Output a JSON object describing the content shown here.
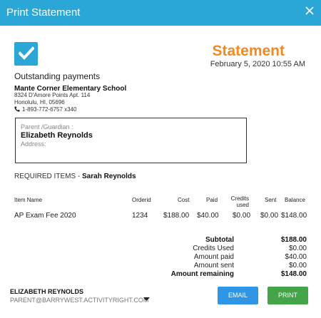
{
  "window": {
    "title": "Print Statement",
    "title_bg": "#2aa7d6"
  },
  "logo": {
    "icon": "checkmark-icon",
    "color": "#2aa7d6"
  },
  "statement": {
    "title": "Statement",
    "title_color": "#f08a24",
    "date": "February 5, 2020 10:55 AM"
  },
  "school": {
    "heading": "Outstanding payments",
    "name": "Mante Corner Elementary School",
    "address_line1": "8324 D'Amore Points Apt. 114",
    "address_line2": "Honolulu, HI, 05696",
    "phone": "1-893-772-6757 x340"
  },
  "guardian": {
    "label": "Parent /Guardian :",
    "name": "Elizabeth Reynolds",
    "address_label": "Address:"
  },
  "required": {
    "label": "REQUIRED ITEMS - ",
    "student": "Sarah Reynolds"
  },
  "table": {
    "headers": {
      "item": "Item Name",
      "order": "Orderid",
      "cost": "Cost",
      "paid": "Paid",
      "credits": "Credits used",
      "sent": "Sent",
      "balance": "Balance"
    },
    "rows": [
      {
        "item": "AP Exam Fee 2020",
        "order": "1234",
        "cost": "$188.00",
        "paid": "$40.00",
        "credits": "$0.00",
        "sent": "$0.00",
        "balance": "$148.00"
      }
    ]
  },
  "summary": {
    "subtotal_label": "Subtotal",
    "subtotal": "$188.00",
    "credits_label": "Credits Used",
    "credits": "$0.00",
    "paid_label": "Amount paid",
    "paid": "$40.00",
    "sent_label": "Amount sent",
    "sent": "$0.00",
    "remaining_label": "Amount remaining",
    "remaining": "$148.00"
  },
  "user": {
    "name": "ELIZABETH REYNOLDS",
    "email": "PARENT@BARRYWEST.ACTIVITYRIGHT.COM"
  },
  "buttons": {
    "email": "EMAIL",
    "email_color": "#2f96e6",
    "print": "PRINT",
    "print_color": "#43a547"
  }
}
